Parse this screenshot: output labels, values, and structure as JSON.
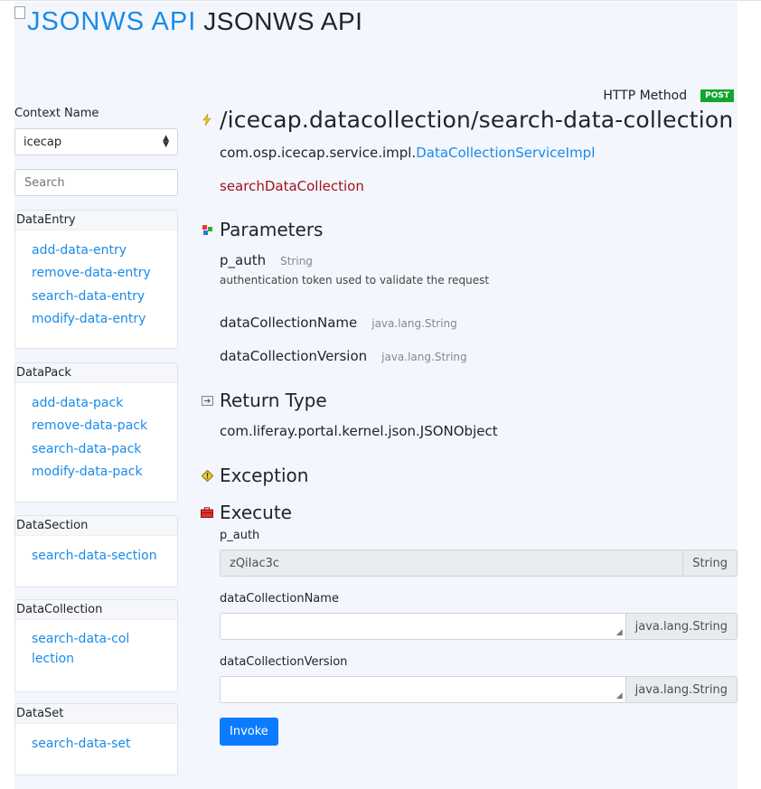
{
  "header": {
    "logo_alt": "JSONWS API",
    "title": "JSONWS API"
  },
  "sidebar": {
    "context_label": "Context Name",
    "context_value": "icecap",
    "search_placeholder": "Search",
    "groups": [
      {
        "name": "DataEntry",
        "items": [
          "add-data-entry",
          "remove-data-entry",
          "search-data-entry",
          "modify-data-entry"
        ]
      },
      {
        "name": "DataPack",
        "items": [
          "add-data-pack",
          "remove-data-pack",
          "search-data-pack",
          "modify-data-pack"
        ]
      },
      {
        "name": "DataSection",
        "items": [
          "search-data-section"
        ]
      },
      {
        "name": "DataCollection",
        "items": [
          "search-data-collection"
        ]
      },
      {
        "name": "DataSet",
        "items": [
          "search-data-set"
        ]
      }
    ]
  },
  "main": {
    "http_label": "HTTP Method",
    "http_method": "POST",
    "path": "/icecap.datacollection/search-data-collection",
    "class_prefix": "com.osp.icecap.service.impl.",
    "class_name": "DataCollectionServiceImpl",
    "method_name": "searchDataCollection",
    "parameters_title": "Parameters",
    "params": [
      {
        "name": "p_auth",
        "type": "String",
        "desc": "authentication token used to validate the request"
      },
      {
        "name": "dataCollectionName",
        "type": "java.lang.String"
      },
      {
        "name": "dataCollectionVersion",
        "type": "java.lang.String"
      }
    ],
    "return_title": "Return Type",
    "return_type": "com.liferay.portal.kernel.json.JSONObject",
    "exception_title": "Exception",
    "execute_title": "Execute",
    "form": [
      {
        "label": "p_auth",
        "value": "zQiIac3c",
        "type": "String"
      },
      {
        "label": "dataCollectionName",
        "value": "",
        "type": "java.lang.String"
      },
      {
        "label": "dataCollectionVersion",
        "value": "",
        "type": "java.lang.String"
      }
    ],
    "invoke_label": "Invoke"
  },
  "colors": {
    "link": "#1a8be8",
    "method": "#a3131b",
    "post_badge": "#12a62f",
    "button": "#0b7bff"
  }
}
